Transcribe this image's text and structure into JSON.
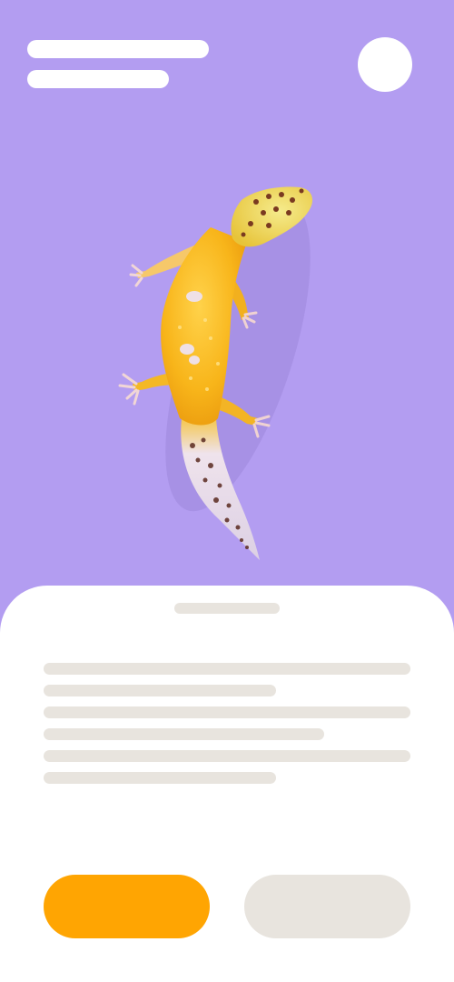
{
  "header": {
    "title_placeholder": "",
    "subtitle_placeholder": "",
    "avatar_icon": "profile-icon"
  },
  "hero": {
    "subject": "leopard-gecko",
    "background_color": "#B39DF1"
  },
  "sheet": {
    "text_placeholder_lines": 6,
    "primary_button_label": "",
    "secondary_button_label": ""
  },
  "colors": {
    "accent": "#FFA502",
    "placeholder_gray": "#E8E4DE",
    "surface": "#FFFFFF"
  }
}
